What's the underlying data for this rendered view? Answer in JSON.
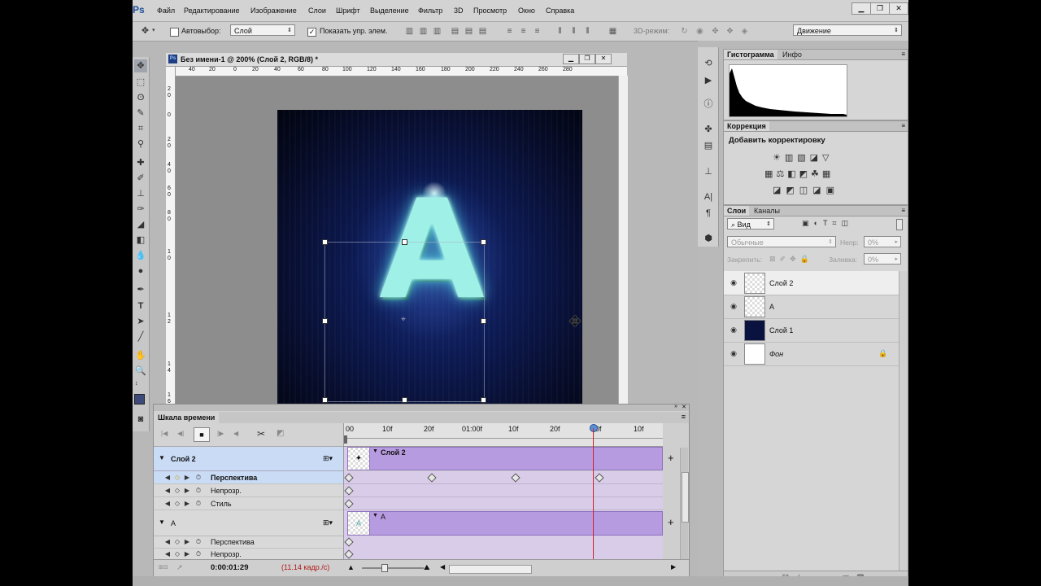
{
  "app": {
    "logo": "Ps"
  },
  "menu": [
    "Файл",
    "Редактирование",
    "Изображение",
    "Слои",
    "Шрифт",
    "Выделение",
    "Фильтр",
    "3D",
    "Просмотр",
    "Окно",
    "Справка"
  ],
  "window_controls": {
    "minimize": "▁",
    "restore": "❐",
    "close": "✕"
  },
  "options": {
    "autoselect_label": "Автовыбор:",
    "autoselect_checked": false,
    "layer_select": "Слой",
    "show_controls_label": "Показать упр. элем.",
    "show_controls_checked": true,
    "mode3d_label": "3D-режим:",
    "workspace": "Движение"
  },
  "document": {
    "title": "Без имени-1 @ 200% (Слой 2, RGB/8) *",
    "ruler_top": [
      "40",
      "20",
      "0",
      "20",
      "40",
      "60",
      "80",
      "100",
      "120",
      "140",
      "160",
      "180",
      "200",
      "220",
      "240",
      "260",
      "280"
    ],
    "ruler_left": [
      "2",
      "0",
      "0",
      "2",
      "0",
      "4",
      "0",
      "6",
      "0",
      "8",
      "0",
      "1",
      "0",
      "1",
      "2",
      "1",
      "4",
      "1",
      "6"
    ],
    "letter": "A"
  },
  "panels": {
    "histogram": {
      "tab_active": "Гистограмма",
      "tab_other": "Инфо"
    },
    "adjustments": {
      "tab": "Коррекция",
      "heading": "Добавить корректировку"
    },
    "layers": {
      "tab_active": "Слои",
      "tab_other": "Каналы",
      "filter_kind": "Вид",
      "blend_mode": "Обычные",
      "opacity_label": "Непр:",
      "opacity_value": "0%",
      "lock_label": "Закрепить:",
      "fill_label": "Заливка:",
      "fill_value": "0%",
      "items": [
        {
          "name": "Слой 2",
          "selected": true,
          "locked": false
        },
        {
          "name": "A",
          "selected": false,
          "locked": false
        },
        {
          "name": "Слой 1",
          "selected": false,
          "locked": false
        },
        {
          "name": "Фон",
          "selected": false,
          "locked": true
        }
      ]
    }
  },
  "timeline": {
    "tab": "Шкала времени",
    "ruler": [
      "00",
      "10f",
      "20f",
      "01:00f",
      "10f",
      "20f",
      "00f",
      "10f"
    ],
    "current_time": "0:00:01:29",
    "fps": "(11.14 кадр./с)",
    "layers": [
      {
        "name": "Слой 2",
        "clip_label": "Слой 2",
        "props": [
          "Перспектива",
          "Непрозр.",
          "Стиль"
        ]
      },
      {
        "name": "A",
        "clip_label": "A",
        "props": [
          "Перспектива",
          "Непрозр."
        ]
      }
    ]
  },
  "colors": {
    "accent_selected": "#c9dbf5",
    "clip": "#b79be0",
    "playhead": "#d11f2d",
    "canvas_bg": "#0a1240",
    "glow": "#7fe7e0"
  }
}
